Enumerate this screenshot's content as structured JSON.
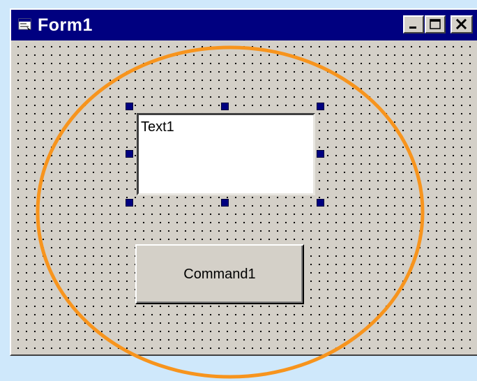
{
  "window": {
    "title": "Form1",
    "title_icon": "form-icon",
    "caption_buttons": [
      "minimize-icon",
      "maximize-icon",
      "close-icon"
    ]
  },
  "form": {
    "textbox": {
      "text": "Text1",
      "selected": true
    },
    "command_button": {
      "label": "Command1"
    }
  },
  "colors": {
    "title_bar": "#000080",
    "window_face": "#d4d0c8",
    "page_background": "#cfe8fb",
    "selection_handle": "#000080",
    "highlight_ellipse": "#f7941d"
  }
}
